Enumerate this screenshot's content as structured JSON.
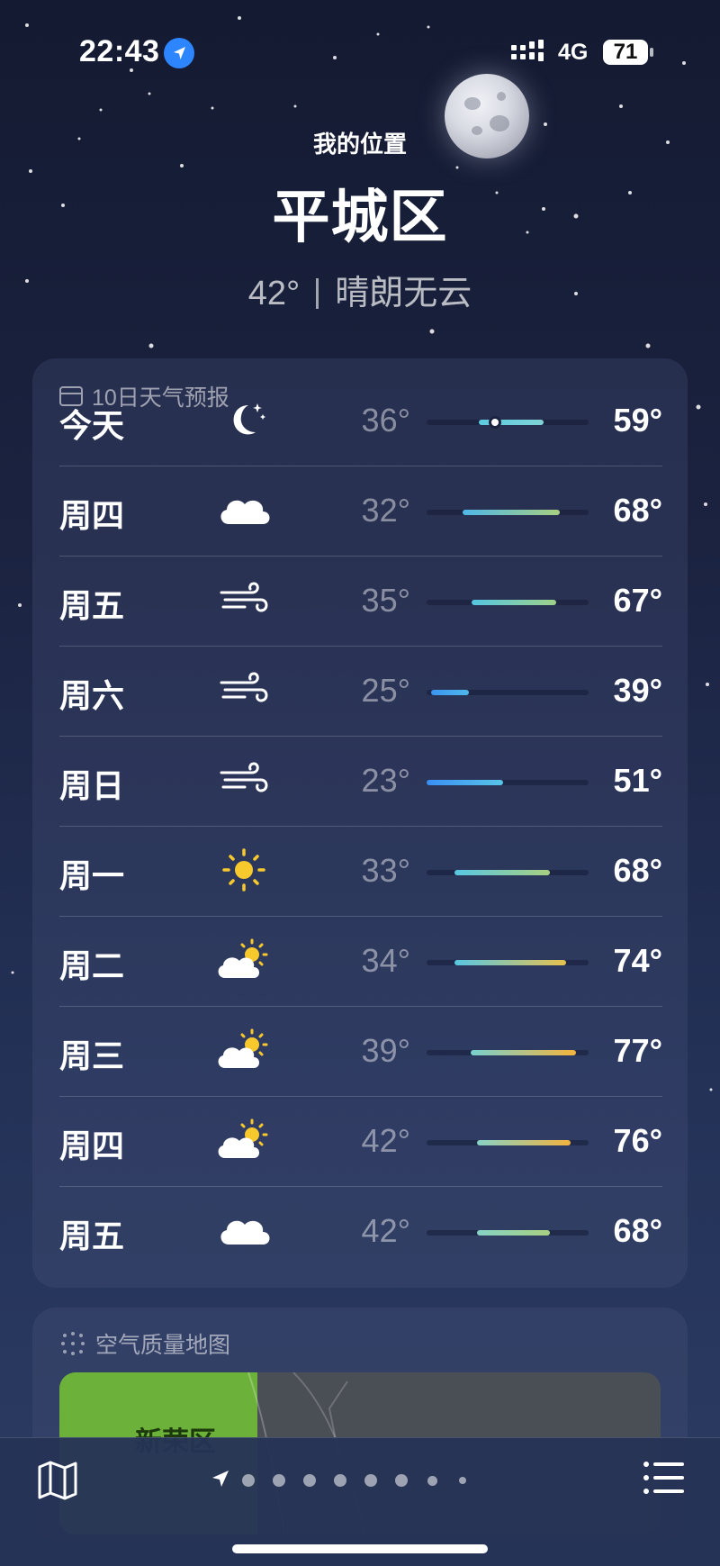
{
  "status_bar": {
    "time": "22:43",
    "network": "4G",
    "battery": "71"
  },
  "header": {
    "subtitle": "我的位置",
    "city": "平城区",
    "current_temp": "42°",
    "condition": "晴朗无云"
  },
  "forecast": {
    "title": "10日天气预报",
    "rows": [
      {
        "day": "今天",
        "icon": "moon-stars-icon",
        "low": "36°",
        "high": "59°",
        "bar_start": 0.32,
        "bar_end": 0.72,
        "bar_colors": [
          "#5ccbe0",
          "#7fd3d6"
        ],
        "now_marker": 0.42
      },
      {
        "day": "周四",
        "icon": "cloud-icon",
        "low": "32°",
        "high": "68°",
        "bar_start": 0.22,
        "bar_end": 0.82,
        "bar_colors": [
          "#4fb8e8",
          "#a8d080"
        ]
      },
      {
        "day": "周五",
        "icon": "wind-icon",
        "low": "35°",
        "high": "67°",
        "bar_start": 0.28,
        "bar_end": 0.8,
        "bar_colors": [
          "#55c6e0",
          "#9fd18a"
        ]
      },
      {
        "day": "周六",
        "icon": "wind-icon",
        "low": "25°",
        "high": "39°",
        "bar_start": 0.03,
        "bar_end": 0.26,
        "bar_colors": [
          "#3b95f2",
          "#4fb8ea"
        ]
      },
      {
        "day": "周日",
        "icon": "wind-icon",
        "low": "23°",
        "high": "51°",
        "bar_start": 0.0,
        "bar_end": 0.47,
        "bar_colors": [
          "#3a8ff3",
          "#58c5e8"
        ]
      },
      {
        "day": "周一",
        "icon": "sun-icon",
        "low": "33°",
        "high": "68°",
        "bar_start": 0.17,
        "bar_end": 0.76,
        "bar_colors": [
          "#58c7e3",
          "#a8d080"
        ]
      },
      {
        "day": "周二",
        "icon": "partly-cloudy-icon",
        "low": "34°",
        "high": "74°",
        "bar_start": 0.17,
        "bar_end": 0.86,
        "bar_colors": [
          "#58c7e3",
          "#e7c24d"
        ]
      },
      {
        "day": "周三",
        "icon": "partly-cloudy-icon",
        "low": "39°",
        "high": "77°",
        "bar_start": 0.27,
        "bar_end": 0.92,
        "bar_colors": [
          "#78d0cf",
          "#f4b43c"
        ]
      },
      {
        "day": "周四",
        "icon": "partly-cloudy-icon",
        "low": "42°",
        "high": "76°",
        "bar_start": 0.31,
        "bar_end": 0.89,
        "bar_colors": [
          "#86d2c5",
          "#f3b33e"
        ]
      },
      {
        "day": "周五",
        "icon": "cloud-icon",
        "low": "42°",
        "high": "68°",
        "bar_start": 0.31,
        "bar_end": 0.76,
        "bar_colors": [
          "#86d2c5",
          "#a8d080"
        ]
      }
    ]
  },
  "air_quality": {
    "title": "空气质量地图",
    "map_label": "新荣区"
  },
  "toolbar": {
    "page_count": 9,
    "active_page": 0
  }
}
